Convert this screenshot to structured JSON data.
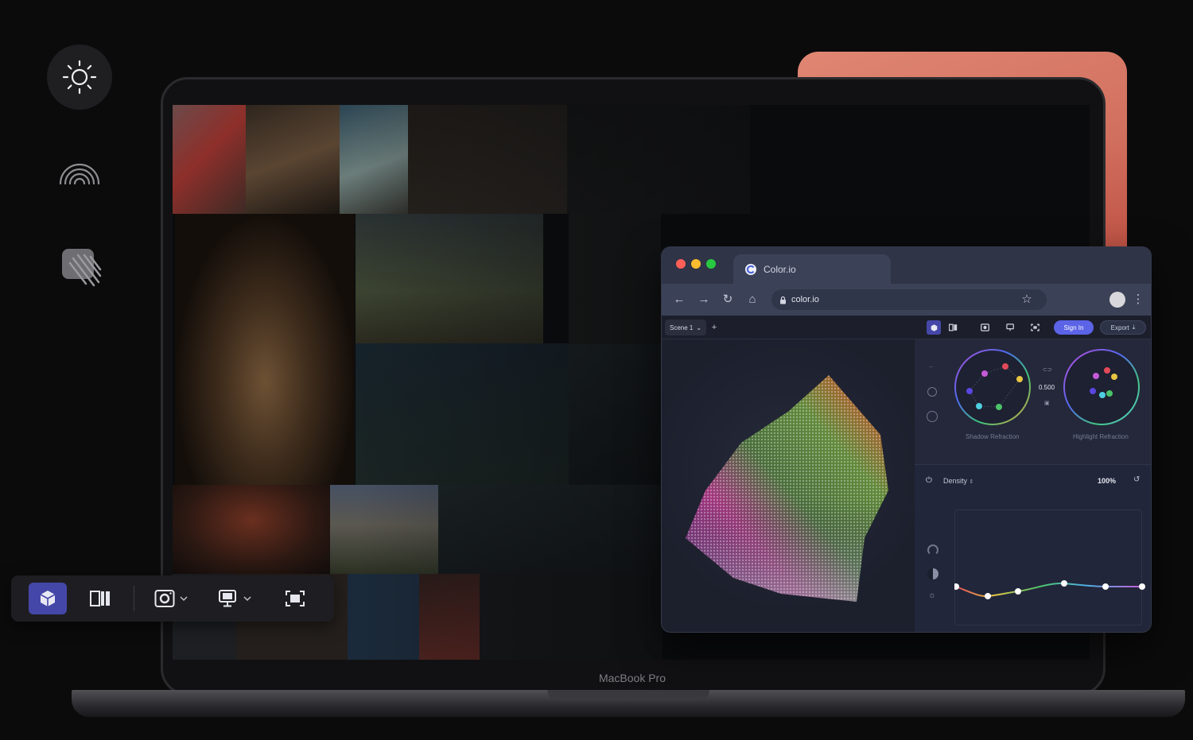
{
  "side_icons": [
    "sun-icon",
    "rainbow-icon",
    "hatch-icon"
  ],
  "laptop": {
    "label": "MacBook Pro"
  },
  "toolbar": {
    "items": [
      "cube-view-icon",
      "compare-icon",
      "camera-icon",
      "display-icon",
      "fullscreen-icon"
    ],
    "accent": "#4547a8"
  },
  "browser": {
    "tab_title": "Color.io",
    "url": "color.io",
    "app": {
      "scene_label": "Scene 1",
      "add_label": "+",
      "sign_in_label": "Sign In",
      "export_label": "Export",
      "wheel_value": "0.500",
      "shadow_label": "Shadow Refraction",
      "highlight_label": "Highlight Refraction",
      "density_label": "Density",
      "density_value": "100%",
      "accent": "#5b63e6"
    }
  }
}
